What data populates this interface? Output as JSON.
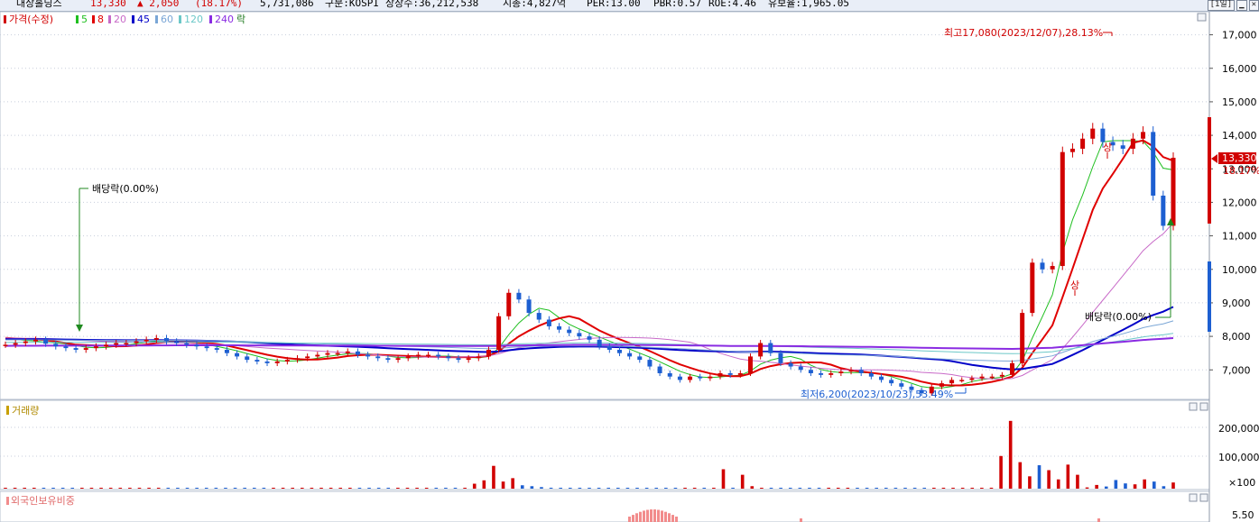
{
  "header": {
    "stock_name": "대상홀딩스",
    "price": "13,330",
    "change": "▲ 2,050",
    "change_pct": "(18.17%)",
    "volume": "5,731,086",
    "market": "구분:KOSPI",
    "shares": "상장수:36,212,538",
    "market_cap": "시총:4,827억",
    "per": "PER:13.00",
    "pbr": "PBR:0.57",
    "roe": "ROE:4.46",
    "float": "유보율:1,965.05",
    "period": "[1일]",
    "up_color": "#d10000",
    "down_color": "#1d5fd1"
  },
  "legend": {
    "price_label": "가격(수정)",
    "ma": [
      {
        "label": "5",
        "color": "#1fbf1f"
      },
      {
        "label": "8",
        "color": "#e00000"
      },
      {
        "label": "20",
        "color": "#c86ac8"
      },
      {
        "label": "45",
        "color": "#0000c8"
      },
      {
        "label": "60",
        "color": "#7aa6d6"
      },
      {
        "label": "120",
        "color": "#6cc8c8"
      },
      {
        "label": "240",
        "color": "#8a2be2"
      }
    ],
    "ex_label": "락"
  },
  "annotations": {
    "dividend_1": "배당락(0.00%)",
    "dividend_2": "배당락(0.00%)",
    "high": "최고17,080(2023/12/07),28.13%",
    "low": "최저6,200(2023/10/23),53.49%",
    "upper_limit_mark": "상"
  },
  "price_panel": {
    "yticks": [
      "17,000",
      "16,000",
      "15,000",
      "14,000",
      "13,000",
      "12,000",
      "11,000",
      "10,000",
      "9,000",
      "8,000",
      "7,000"
    ],
    "current_price_tag": "13,330",
    "current_pct_tag": "18.17%"
  },
  "volume_panel": {
    "title": "거래량",
    "yticks": [
      "200,000",
      "100,000"
    ],
    "unit": "×100"
  },
  "foreign_panel": {
    "title": "외국인보유비중",
    "ytick": "5.50"
  },
  "chart_data": [
    {
      "type": "candlestick",
      "title": "가격(수정)",
      "ylim": [
        6200,
        17500
      ],
      "ma_series": [
        "5",
        "8",
        "20",
        "45",
        "60",
        "120",
        "240"
      ],
      "close_approx": [
        7750,
        7800,
        7850,
        7900,
        7780,
        7700,
        7650,
        7600,
        7650,
        7700,
        7750,
        7800,
        7800,
        7850,
        7900,
        7950,
        7850,
        7800,
        7750,
        7700,
        7650,
        7600,
        7500,
        7400,
        7300,
        7250,
        7200,
        7250,
        7300,
        7350,
        7400,
        7450,
        7500,
        7500,
        7550,
        7450,
        7400,
        7350,
        7300,
        7350,
        7400,
        7450,
        7450,
        7400,
        7350,
        7300,
        7350,
        7400,
        7600,
        8600,
        9300,
        9100,
        8700,
        8500,
        8300,
        8200,
        8100,
        8000,
        7900,
        7700,
        7600,
        7500,
        7400,
        7300,
        7100,
        6900,
        6800,
        6700,
        6800,
        6750,
        6800,
        6900,
        6850,
        6900,
        7400,
        7800,
        7500,
        7200,
        7100,
        7000,
        6900,
        6850,
        6900,
        6950,
        7000,
        6900,
        6800,
        6700,
        6600,
        6500,
        6400,
        6300,
        6500,
        6600,
        6700,
        6700,
        6750,
        6800,
        6800,
        6850,
        7200,
        8700,
        10200,
        10000,
        10100,
        13500,
        13600,
        13900,
        14200,
        13800,
        13700,
        13600,
        13900,
        14100,
        12200,
        11300,
        13330
      ],
      "ex_dividend_marks": 2
    },
    {
      "type": "bar",
      "title": "거래량",
      "unit": "×100",
      "ylim": [
        0,
        240000
      ],
      "values_approx": [
        600,
        400,
        300,
        400,
        300,
        300,
        200,
        300,
        200,
        300,
        200,
        300,
        300,
        200,
        300,
        200,
        200,
        200,
        200,
        200,
        200,
        200,
        200,
        200,
        200,
        200,
        200,
        200,
        200,
        200,
        200,
        200,
        200,
        200,
        200,
        200,
        200,
        200,
        200,
        200,
        200,
        200,
        200,
        200,
        200,
        200,
        200,
        300,
        1800,
        16000,
        27000,
        74000,
        23000,
        34000,
        11000,
        8000,
        5000,
        3000,
        2000,
        1500,
        1000,
        800,
        700,
        600,
        500,
        500,
        500,
        500,
        500,
        500,
        500,
        500,
        500,
        500,
        500,
        63000,
        3000,
        45000,
        8000,
        2000,
        1000,
        700,
        500,
        500,
        500,
        500,
        500,
        500,
        500,
        500,
        500,
        500,
        500,
        500,
        500,
        500,
        500,
        500,
        500,
        500,
        500,
        500,
        1000,
        3000,
        106000,
        220000,
        86000,
        40000,
        76000,
        60000,
        30000,
        78000,
        45000,
        4000,
        12000,
        7000,
        28000,
        17000,
        14000,
        30000,
        23000,
        8000,
        20000
      ]
    },
    {
      "type": "bar",
      "title": "외국인보유비중",
      "note": "partially visible"
    }
  ]
}
